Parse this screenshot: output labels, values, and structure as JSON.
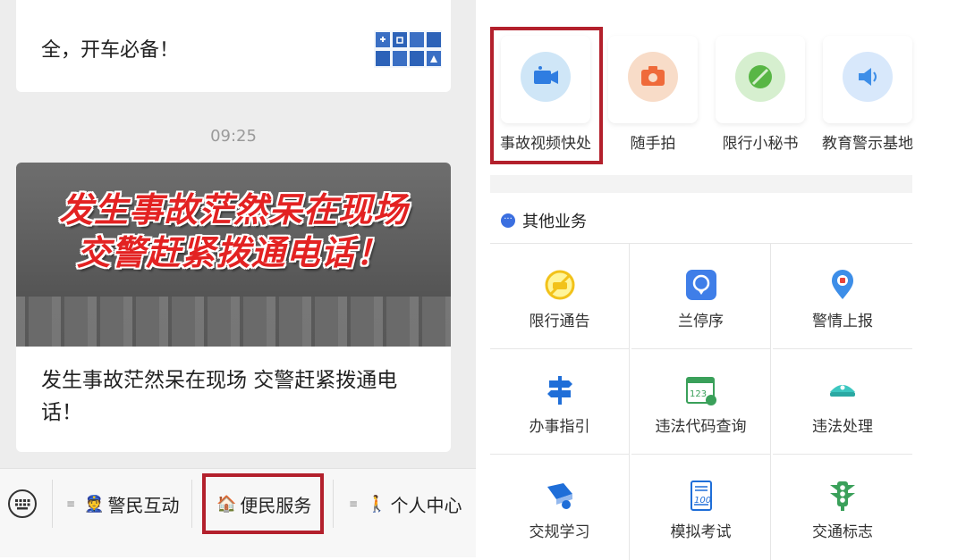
{
  "left": {
    "card1_text": "全，开车必备！",
    "timestamp": "09:25",
    "banner_line1": "发生事故茫然呆在现场",
    "banner_line2": "交警赶紧拨通电话！",
    "caption": "发生事故茫然呆在现场  交警赶紧拨通电话！",
    "menu": [
      {
        "label": "警民互动",
        "emoji": "👮"
      },
      {
        "label": "便民服务",
        "emoji": "🏠"
      },
      {
        "label": "个人中心",
        "emoji": "🚶"
      }
    ]
  },
  "right": {
    "top_items": [
      {
        "label": "事故视频快处",
        "icon": "video-camera-icon",
        "color": "#cfe6f7",
        "fg": "#2f7de1"
      },
      {
        "label": "随手拍",
        "icon": "camera-icon",
        "color": "#f8dcc8",
        "fg": "#ef6a3a"
      },
      {
        "label": "限行小秘书",
        "icon": "no-entry-icon",
        "color": "#d6efcf",
        "fg": "#58b645"
      },
      {
        "label": "教育警示基地",
        "icon": "speaker-icon",
        "color": "#d8e8fb",
        "fg": "#3d8ee8"
      }
    ],
    "section_title": "其他业务",
    "grid": [
      {
        "label": "限行通告",
        "icon": "restricted-car-icon"
      },
      {
        "label": "兰停序",
        "icon": "parking-pin-icon"
      },
      {
        "label": "警情上报",
        "icon": "alarm-location-icon"
      },
      {
        "label": "办事指引",
        "icon": "signpost-icon"
      },
      {
        "label": "违法代码查询",
        "icon": "code-calendar-icon"
      },
      {
        "label": "违法处理",
        "icon": "police-cap-icon"
      },
      {
        "label": "交规学习",
        "icon": "study-book-icon"
      },
      {
        "label": "模拟考试",
        "icon": "exam-paper-icon"
      },
      {
        "label": "交通标志",
        "icon": "traffic-light-icon"
      }
    ]
  },
  "colors": {
    "highlight_box": "#b3202c",
    "banner_text": "#e32222"
  }
}
